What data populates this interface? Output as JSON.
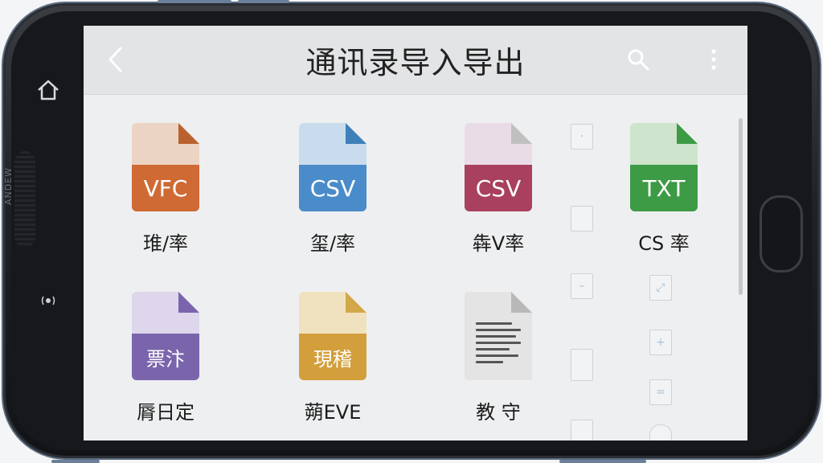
{
  "header": {
    "title": "通讯录导入导出",
    "back_icon": "chevron-left-icon",
    "search_icon": "search-icon",
    "more_icon": "more-vertical-icon"
  },
  "device": {
    "side_label": "ANDEW"
  },
  "grid": {
    "items": [
      {
        "badge": "VFC",
        "label": "琟/率",
        "top_color": "#ecd4c4",
        "bottom_color": "#cf6a34",
        "fold_color": "#b9622f"
      },
      {
        "badge": "CSV",
        "label": "玺/率",
        "top_color": "#c9dcee",
        "bottom_color": "#4a8cc9",
        "fold_color": "#3f7fba"
      },
      {
        "badge": "CSV",
        "label": "犇V率",
        "top_color": "#eadce6",
        "bottom_color": "#a8405e",
        "fold_color": "#c0c0c0"
      },
      {
        "badge": "TXT",
        "label": "CS 率",
        "top_color": "#cfe4cc",
        "bottom_color": "#3d9a45",
        "fold_color": "#3d9a45"
      },
      {
        "badge": "票汴",
        "label": "脣日定",
        "top_color": "#ddd6ec",
        "bottom_color": "#7a65ad",
        "fold_color": "#7a65ad"
      },
      {
        "badge": "現稽",
        "label": "蒴EVE",
        "top_color": "#f1e2bf",
        "bottom_color": "#d29f3c",
        "fold_color": "#d2a84a"
      },
      {
        "badge": "",
        "label": "教 守",
        "top_color": "#e4e4e4",
        "bottom_color": "#e4e4e4",
        "fold_color": "#b9b9b9"
      }
    ]
  },
  "colors": {
    "appbar": "#e3e4e6",
    "screen": "#eeeff0"
  }
}
